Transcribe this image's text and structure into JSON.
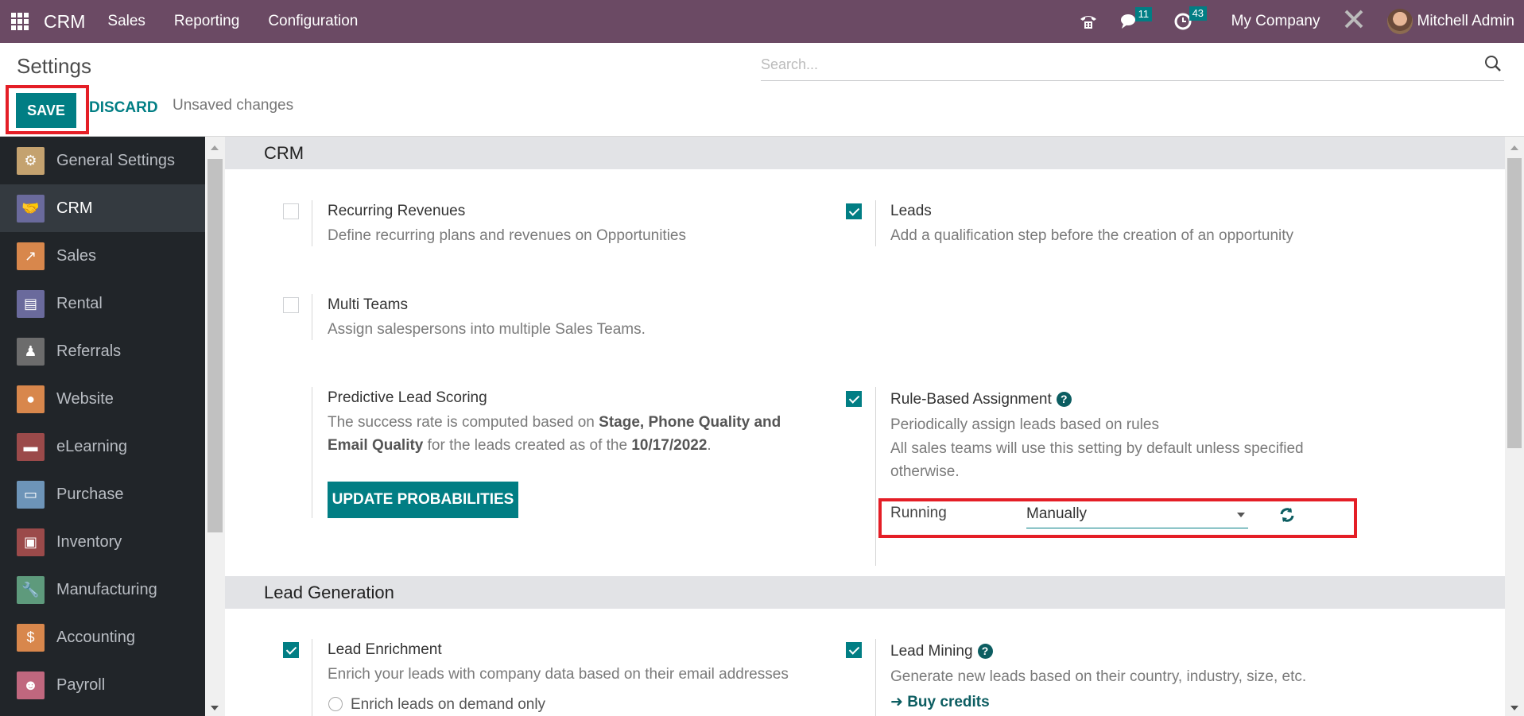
{
  "topbar": {
    "app_name": "CRM",
    "menus": [
      "Sales",
      "Reporting",
      "Configuration"
    ],
    "messages_badge": "11",
    "activities_badge": "43",
    "company": "My Company",
    "user": "Mitchell Admin"
  },
  "control_panel": {
    "title": "Settings",
    "save_label": "SAVE",
    "discard_label": "DISCARD",
    "status": "Unsaved changes",
    "search_placeholder": "Search..."
  },
  "sidebar": {
    "items": [
      {
        "label": "General Settings",
        "icon": "gear-icon",
        "color": "#c4a26f",
        "active": false
      },
      {
        "label": "CRM",
        "icon": "handshake-icon",
        "color": "#6a6a9c",
        "active": true
      },
      {
        "label": "Sales",
        "icon": "chart-up-icon",
        "color": "#d8874c",
        "active": false
      },
      {
        "label": "Rental",
        "icon": "calendar-grid-icon",
        "color": "#6a6a9c",
        "active": false
      },
      {
        "label": "Referrals",
        "icon": "person-icon",
        "color": "#6c6c6c",
        "active": false
      },
      {
        "label": "Website",
        "icon": "globe-icon",
        "color": "#d8874c",
        "active": false
      },
      {
        "label": "eLearning",
        "icon": "presentation-icon",
        "color": "#9b4a4a",
        "active": false
      },
      {
        "label": "Purchase",
        "icon": "credit-card-icon",
        "color": "#6d94b8",
        "active": false
      },
      {
        "label": "Inventory",
        "icon": "box-icon",
        "color": "#9b4a4a",
        "active": false
      },
      {
        "label": "Manufacturing",
        "icon": "wrench-icon",
        "color": "#5e9a7c",
        "active": false
      },
      {
        "label": "Accounting",
        "icon": "invoice-icon",
        "color": "#d8874c",
        "active": false
      },
      {
        "label": "Payroll",
        "icon": "payroll-icon",
        "color": "#c0677e",
        "active": false
      }
    ]
  },
  "sections": {
    "crm": {
      "title": "CRM",
      "recurring": {
        "title": "Recurring Revenues",
        "desc": "Define recurring plans and revenues on Opportunities",
        "checked": false
      },
      "leads": {
        "title": "Leads",
        "desc": "Add a qualification step before the creation of an opportunity",
        "checked": true
      },
      "multi_teams": {
        "title": "Multi Teams",
        "desc": "Assign salespersons into multiple Sales Teams.",
        "checked": false
      },
      "pls": {
        "title": "Predictive Lead Scoring",
        "desc_1": "The success rate is computed based on ",
        "desc_bold_1": "Stage, Phone Quality and Email Quality",
        "desc_2": " for the leads created as of the ",
        "desc_bold_2": "10/17/2022",
        "desc_3": ".",
        "button": "UPDATE PROBABILITIES"
      },
      "rba": {
        "title": "Rule-Based Assignment",
        "checked": true,
        "desc_1": "Periodically assign leads based on rules",
        "desc_2": "All sales teams will use this setting by default unless specified otherwise.",
        "running_label": "Running",
        "running_value": "Manually"
      }
    },
    "lead_gen": {
      "title": "Lead Generation",
      "enrichment": {
        "title": "Lead Enrichment",
        "desc": "Enrich your leads with company data based on their email addresses",
        "checked": true,
        "option": "Enrich leads on demand only"
      },
      "mining": {
        "title": "Lead Mining",
        "desc": "Generate new leads based on their country, industry, size, etc.",
        "checked": true,
        "link": "Buy credits"
      }
    }
  },
  "colors": {
    "brand": "#6b4a64",
    "accent": "#017e84",
    "highlight": "#e41e26"
  }
}
